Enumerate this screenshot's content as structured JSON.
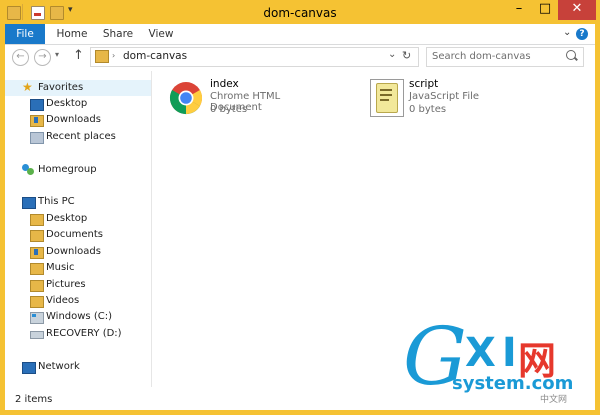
{
  "window": {
    "title": "dom-canvas",
    "minimize": "–",
    "maximize": "□",
    "close": "✕"
  },
  "ribbon": {
    "tabs": [
      "File",
      "Home",
      "Share",
      "View"
    ],
    "expand": "⌄",
    "help": "?"
  },
  "address": {
    "path": "dom-canvas",
    "search_placeholder": "Search dom-canvas",
    "back": "←",
    "forward": "→",
    "up": "↑",
    "dropdown": "⌄",
    "refresh": "↻",
    "search_icon": "🔍"
  },
  "nav": {
    "favorites": {
      "label": "Favorites",
      "items": [
        "Desktop",
        "Downloads",
        "Recent places"
      ]
    },
    "homegroup": "Homegroup",
    "this_pc": {
      "label": "This PC",
      "items": [
        "Desktop",
        "Documents",
        "Downloads",
        "Music",
        "Pictures",
        "Videos",
        "Windows (C:)",
        "RECOVERY (D:)"
      ]
    },
    "network": "Network"
  },
  "files": [
    {
      "name": "index",
      "type": "Chrome HTML Document",
      "size": "0 bytes",
      "icon": "chrome-icon"
    },
    {
      "name": "script",
      "type": "JavaScript File",
      "size": "0 bytes",
      "icon": "script-icon"
    }
  ],
  "status": {
    "count": "2 items"
  },
  "watermark": {
    "g": "G",
    "xi": "XI",
    "cn": "网",
    "domain": "system.com",
    "small": "中文网"
  },
  "colors": {
    "accent": "#1979ca",
    "frame": "#f5c233",
    "selection": "#e5f3fb",
    "close": "#c7413a"
  }
}
